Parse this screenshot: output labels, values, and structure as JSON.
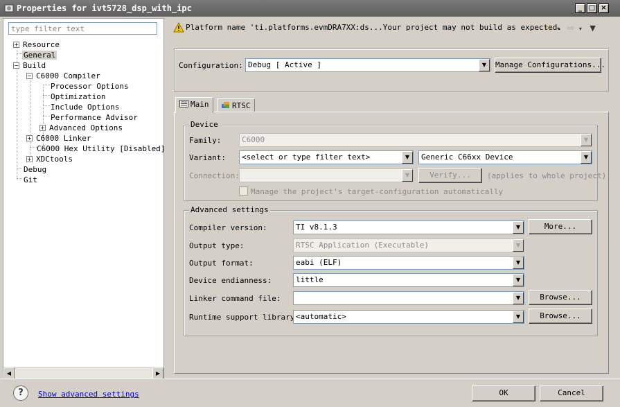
{
  "window": {
    "title": "Properties for ivt5728_dsp_with_ipc",
    "min_glyph": "_",
    "max_glyph": "□",
    "close_glyph": "×"
  },
  "sidebar": {
    "filter_placeholder": "type filter text",
    "items": [
      {
        "label": "Resource",
        "expander": "+"
      },
      {
        "label": "General",
        "selected": true
      },
      {
        "label": "Build",
        "expander": "−"
      },
      {
        "label": "C6000 Compiler",
        "expander": "−"
      },
      {
        "label": "Processor Options"
      },
      {
        "label": "Optimization"
      },
      {
        "label": "Include Options"
      },
      {
        "label": "Performance Advisor"
      },
      {
        "label": "Advanced Options",
        "expander": "+"
      },
      {
        "label": "C6000 Linker",
        "expander": "+"
      },
      {
        "label": "C6000 Hex Utility  [Disabled]"
      },
      {
        "label": "XDCtools",
        "expander": "+"
      },
      {
        "label": "Debug"
      },
      {
        "label": "Git"
      }
    ],
    "scroll_left_glyph": "◀",
    "scroll_right_glyph": "▶"
  },
  "warning": {
    "icon": "warning-triangle-icon",
    "text": "Platform name 'ti.platforms.evmDRA7XX:ds...Your project may not build as expected."
  },
  "nav": {
    "back_glyph": "⇦",
    "forward_glyph": "⇨",
    "dropdown_glyph": "▾",
    "menu_glyph": "▼"
  },
  "configuration": {
    "label": "Configuration:",
    "value": "Debug  [ Active ]",
    "manage_button": "Manage Configurations..."
  },
  "tabs": [
    {
      "label": "Main",
      "active": true
    },
    {
      "label": "RTSC",
      "active": false
    }
  ],
  "device": {
    "group_title": "Device",
    "family_label": "Family:",
    "family_value": "C6000",
    "variant_label": "Variant:",
    "variant_filter": "<select or type filter text>",
    "variant_value": "Generic C66xx Device",
    "connection_label": "Connection:",
    "connection_value": "",
    "verify_button": "Verify...",
    "applies_text": "(applies to whole project)",
    "manage_target_label": "Manage the project's target-configuration automatically"
  },
  "advanced": {
    "group_title": "Advanced settings",
    "compiler_version_label": "Compiler version:",
    "compiler_version_value": "TI v8.1.3",
    "more_button": "More...",
    "output_type_label": "Output type:",
    "output_type_value": "RTSC Application (Executable)",
    "output_format_label": "Output format:",
    "output_format_value": "eabi (ELF)",
    "endianness_label": "Device endianness:",
    "endianness_value": "little",
    "linker_cmd_label": "Linker command file:",
    "linker_cmd_value": "",
    "browse_button_1": "Browse...",
    "rts_label": "Runtime support library:",
    "rts_value": "<automatic>",
    "browse_button_2": "Browse..."
  },
  "dropdown_glyph": "▼",
  "footer": {
    "help_glyph": "?",
    "show_advanced": "Show advanced settings",
    "ok": "OK",
    "cancel": "Cancel"
  }
}
